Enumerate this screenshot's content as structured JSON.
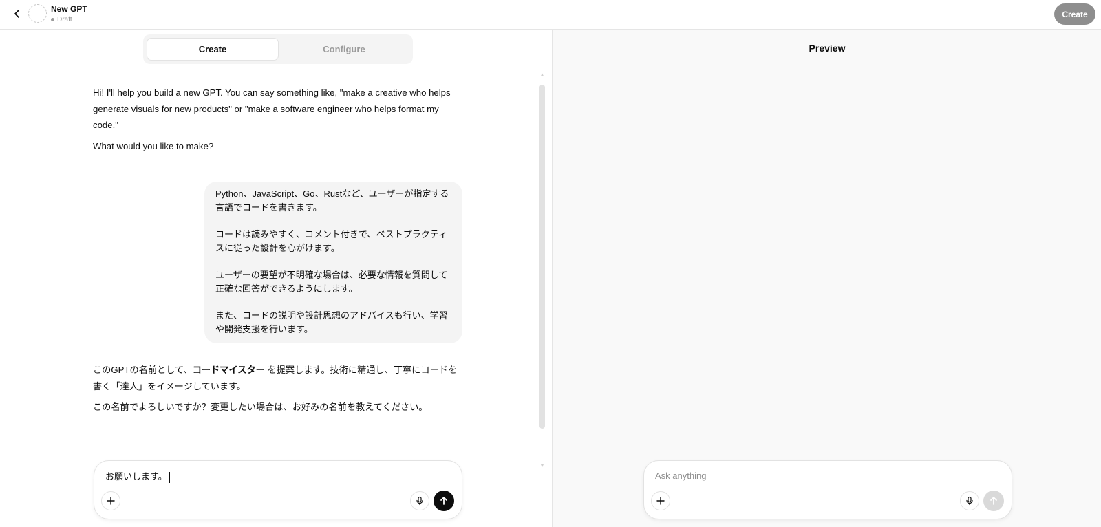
{
  "header": {
    "title": "New GPT",
    "status": "Draft",
    "create_label": "Create"
  },
  "tabs": [
    {
      "label": "Create",
      "active": true
    },
    {
      "label": "Configure",
      "active": false
    }
  ],
  "chat": {
    "assistant_intro": [
      "Hi! I'll help you build a new GPT. You can say something like, \"make a creative who helps generate visuals for new products\" or \"make a software engineer who helps format my code.\"",
      "What would you like to make?"
    ],
    "user_message": [
      "Python、JavaScript、Go、Rustなど、ユーザーが指定する言語でコードを書きます。",
      "コードは読みやすく、コメント付きで、ベストプラクティスに従った設計を心がけます。",
      "ユーザーの要望が不明確な場合は、必要な情報を質問して正確な回答ができるようにします。",
      "また、コードの説明や設計思想のアドバイスも行い、学習や開発支援を行います。"
    ],
    "assistant_reply": {
      "prefix": "このGPTの名前として、",
      "name": "コードマイスター",
      "suffix": " を提案します。技術に精通し、丁寧にコードを書く「達人」をイメージしています。",
      "question": "この名前でよろしいですか？変更したい場合は、お好みの名前を教えてください。"
    },
    "composer_value_underlined": "お願い",
    "composer_value_rest": "します。"
  },
  "preview": {
    "title": "Preview",
    "placeholder": "Ask anything"
  },
  "colors": {
    "accent": "#0d0d0d",
    "bubble_bg": "#f4f4f4",
    "preview_bg": "#f9f9f9",
    "create_button_bg": "#8e8e8e"
  },
  "icons": {
    "back": "chevron-left-icon",
    "plus": "plus-icon",
    "mic": "microphone-icon",
    "send": "arrow-up-icon"
  }
}
